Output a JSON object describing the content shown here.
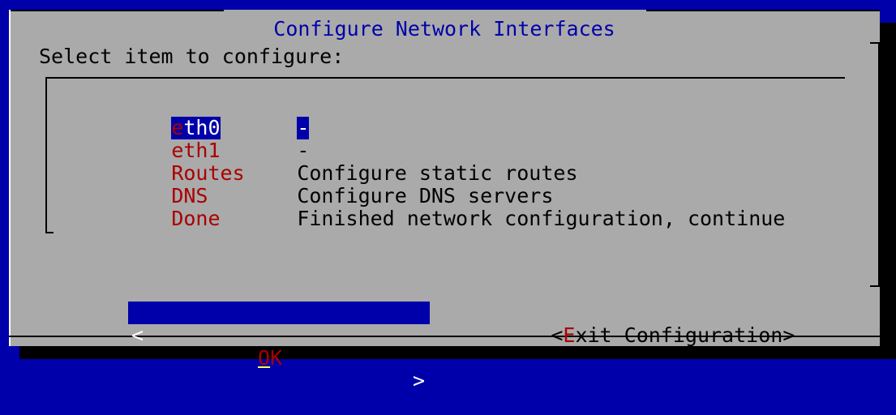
{
  "dialog": {
    "title": "Configure Network Interfaces",
    "prompt": "Select item to configure:"
  },
  "menu": {
    "items": [
      {
        "tag_hot": "e",
        "tag_rest": "th0",
        "tag": "eth0",
        "description": "-",
        "selected": true
      },
      {
        "tag": "eth1",
        "description": "-",
        "selected": false
      },
      {
        "tag": "Routes",
        "description": "Configure static routes",
        "selected": false
      },
      {
        "tag": "DNS",
        "description": "Configure DNS servers",
        "selected": false
      },
      {
        "tag": "Done",
        "description": "Finished network configuration, continue",
        "selected": false
      }
    ]
  },
  "buttons": {
    "ok": {
      "left": "<",
      "hot": "O",
      "rest": "K",
      "right": ">"
    },
    "exit": {
      "open": "<",
      "hot": "E",
      "rest": "xit Configuration",
      "close": ">"
    }
  },
  "colors": {
    "screen_bg": "#0000aa",
    "dialog_bg": "#aaaaaa",
    "title": "#0000aa",
    "hotkey": "#aa0000",
    "selection_bg": "#0000aa",
    "selection_fg": "#ffffff"
  }
}
